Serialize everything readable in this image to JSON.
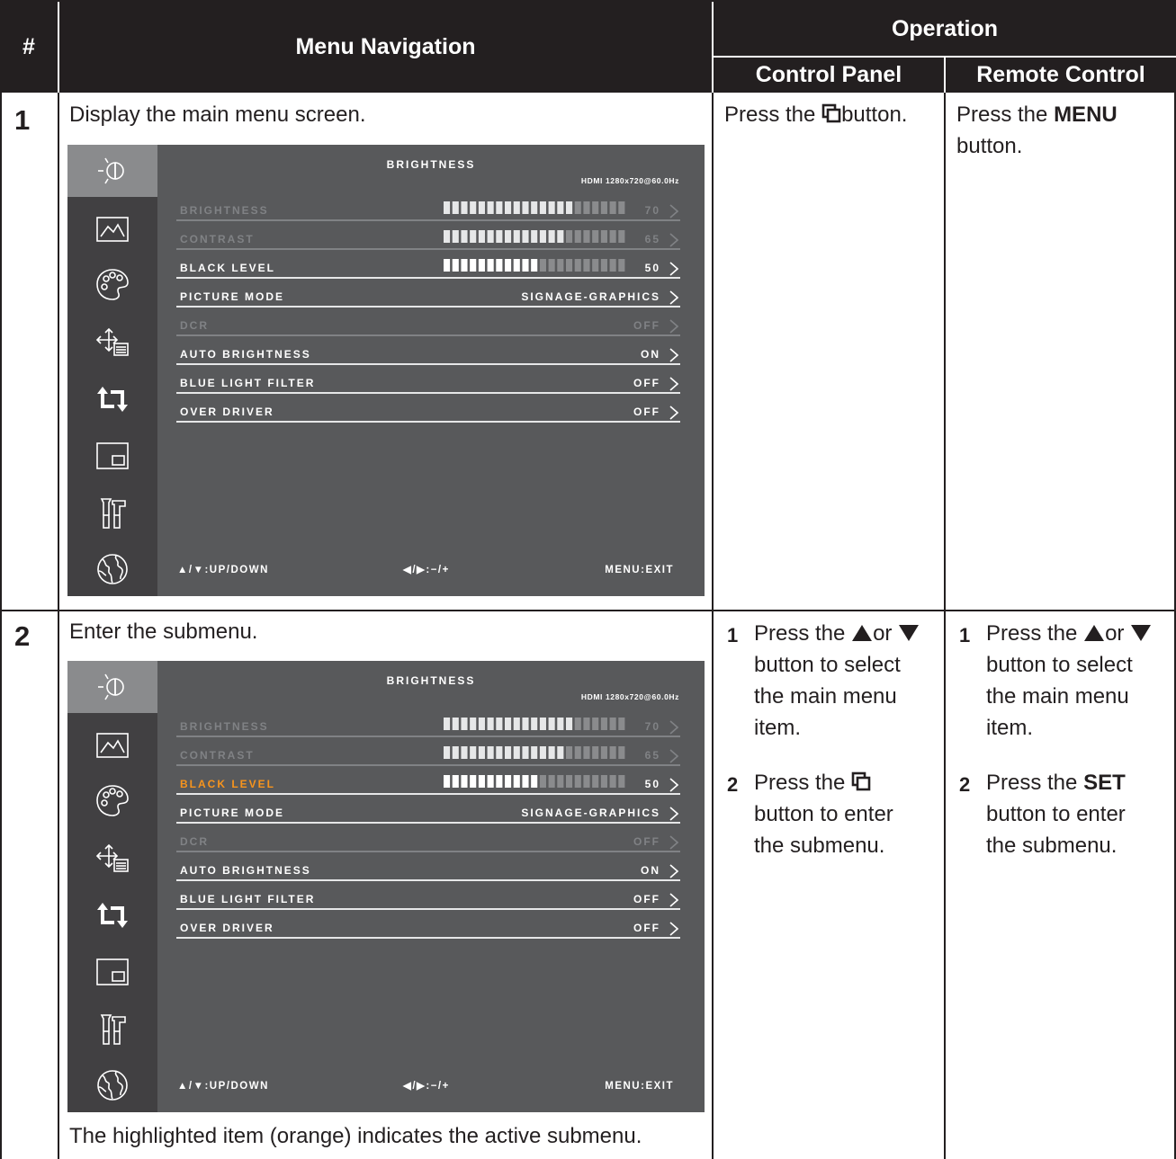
{
  "table": {
    "col_hash": "#",
    "col_nav": "Menu Navigation",
    "col_operation": "Operation",
    "col_control_panel": "Control Panel",
    "col_remote_control": "Remote Control"
  },
  "rows": [
    {
      "number": "1",
      "description": "Display the main menu screen.",
      "control_panel": {
        "pre": "Press the",
        "post": "button.",
        "icon": "menu-button-icon"
      },
      "remote": {
        "pre": "Press the",
        "bold": "MENU",
        "post": "button."
      }
    },
    {
      "number": "2",
      "description": "Enter the submenu.",
      "note": "The highlighted item (orange) indicates the active submenu.",
      "control_panel_steps": [
        {
          "n": "1",
          "l1a": "Press the",
          "l1b": "or",
          "l2": "button to select",
          "l3": "the main menu",
          "l4": "item."
        },
        {
          "n": "2",
          "l1a": "Press the",
          "l2": "button to enter",
          "l3": "the submenu."
        }
      ],
      "remote_steps": [
        {
          "n": "1",
          "l1a": "Press the",
          "l1b": "or",
          "l2": "button to select",
          "l3": "the main menu",
          "l4": "item."
        },
        {
          "n": "2",
          "l1a": "Press the",
          "bold": "SET",
          "l2": "button to enter",
          "l3": "the submenu."
        }
      ]
    }
  ],
  "osd": {
    "title": "BRIGHTNESS",
    "source": "HDMI 1280x720@60.0Hz",
    "items": [
      {
        "label": "BRIGHTNESS",
        "value": "70",
        "level": 0.7,
        "state": "dim"
      },
      {
        "label": "CONTRAST",
        "value": "65",
        "level": 0.65,
        "state": "dim"
      },
      {
        "label": "BLACK LEVEL",
        "value": "50",
        "level": 0.5,
        "state": "normal"
      },
      {
        "label": "PICTURE MODE",
        "value": "SIGNAGE-GRAPHICS",
        "state": "normal"
      },
      {
        "label": "DCR",
        "value": "OFF",
        "state": "dim"
      },
      {
        "label": "AUTO BRIGHTNESS",
        "value": "ON",
        "state": "normal"
      },
      {
        "label": "BLUE LIGHT FILTER",
        "value": "OFF",
        "state": "normal"
      },
      {
        "label": "OVER DRIVER",
        "value": "OFF",
        "state": "normal"
      }
    ],
    "footer": {
      "updown": "▲/▼:UP/DOWN",
      "adjust": "◀/▶:−/+",
      "exit": "MENU:EXIT"
    },
    "highlight_color": "#f7941d",
    "sidebar_icons": [
      "brightness-icon",
      "image-icon",
      "color-palette-icon",
      "position-icon",
      "input-switch-icon",
      "pip-icon",
      "tools-icon",
      "globe-icon"
    ]
  }
}
